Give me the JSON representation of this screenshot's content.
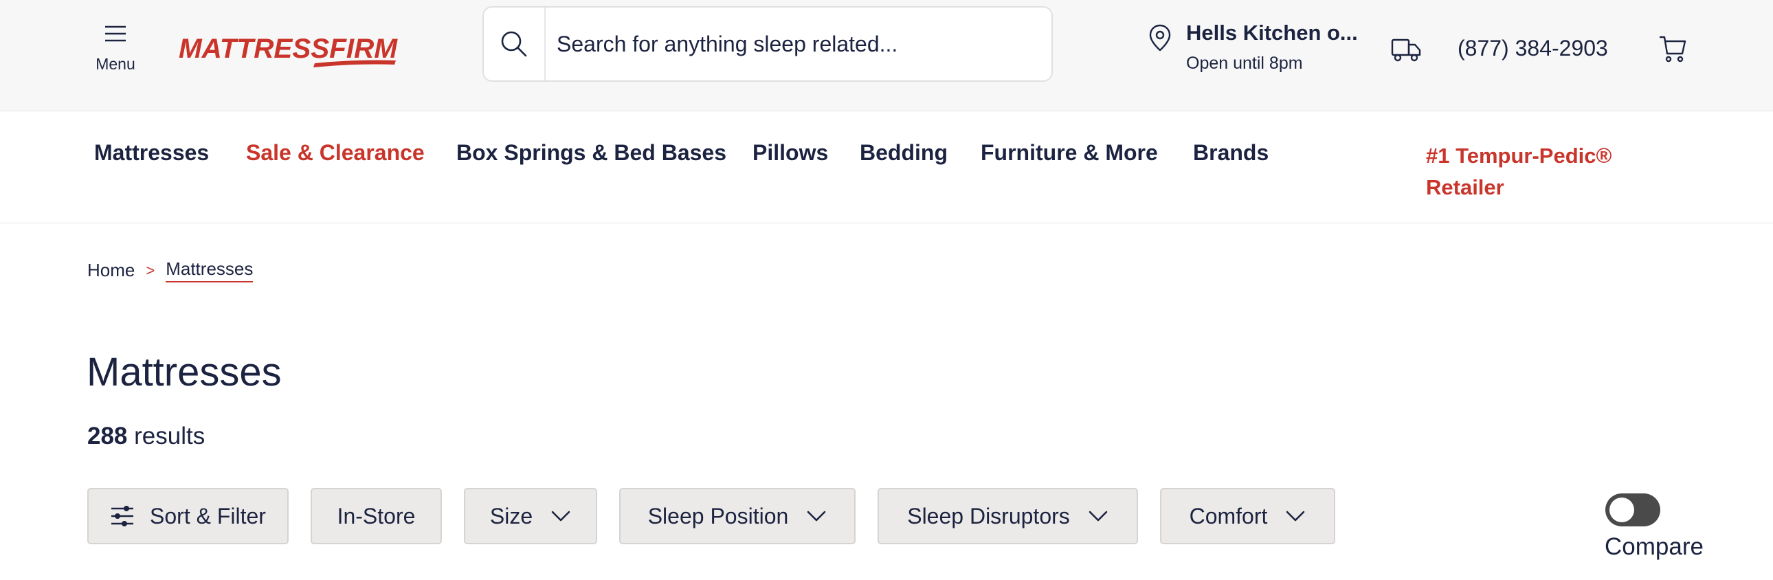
{
  "header": {
    "menu_label": "Menu",
    "logo_text": "MATTRESSFIRM",
    "search_placeholder": "Search for anything sleep related...",
    "store_name": "Hells Kitchen o...",
    "store_hours": "Open until 8pm",
    "phone": "(877) 384-2903"
  },
  "nav": {
    "items": [
      "Mattresses",
      "Sale & Clearance",
      "Box Springs & Bed Bases",
      "Pillows",
      "Bedding",
      "Furniture & More",
      "Brands"
    ],
    "promo_line1": "#1 Tempur-Pedic®",
    "promo_line2": "Retailer"
  },
  "breadcrumb": {
    "home": "Home",
    "separator": ">",
    "current": "Mattresses"
  },
  "page": {
    "title": "Mattresses",
    "result_count": "288",
    "result_label": "results"
  },
  "filters": {
    "sort_filter": "Sort & Filter",
    "in_store": "In-Store",
    "size": "Size",
    "sleep_position": "Sleep Position",
    "sleep_disruptors": "Sleep Disruptors",
    "comfort": "Comfort"
  },
  "compare": {
    "label": "Compare",
    "enabled": false
  },
  "colors": {
    "brand_red": "#c9352b",
    "navy_text": "#1c2340",
    "header_bg": "#f7f7f7",
    "chip_bg": "#eceae8",
    "toggle_off": "#4a4a4a"
  },
  "icons": [
    "hamburger-icon",
    "search-icon",
    "location-pin-icon",
    "delivery-truck-icon",
    "cart-icon",
    "sliders-icon",
    "chevron-down-icon"
  ]
}
